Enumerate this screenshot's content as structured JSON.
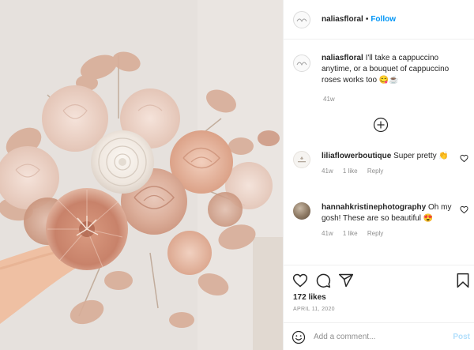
{
  "header": {
    "username": "naliasfloral",
    "separator": "•",
    "follow_label": "Follow"
  },
  "caption": {
    "username": "naliasfloral",
    "text": "I'll take a cappuccino anytime, or a bouquet of cappuccino roses works too 😋☕",
    "time": "41w"
  },
  "more_icon": "plus-circle-icon",
  "comments": [
    {
      "username": "liliaflowerboutique",
      "text": "Super pretty 👏",
      "time": "41w",
      "likes": "1 like",
      "reply": "Reply"
    },
    {
      "username": "hannahkristinephotography",
      "text": "Oh my gosh! These are so beautiful 😍",
      "time": "41w",
      "likes": "1 like",
      "reply": "Reply"
    }
  ],
  "actions": {
    "icons": [
      "heart-icon",
      "comment-icon",
      "share-icon",
      "bookmark-icon"
    ],
    "likes": "172 likes",
    "date": "APRIL 11, 2020"
  },
  "add_comment": {
    "placeholder": "Add a comment...",
    "post_label": "Post",
    "emoji_icon": "smiley-icon"
  },
  "colors": {
    "follow": "#0095f6",
    "post_disabled": "#b2dffc",
    "meta": "#8e8e8e",
    "text": "#262626"
  }
}
